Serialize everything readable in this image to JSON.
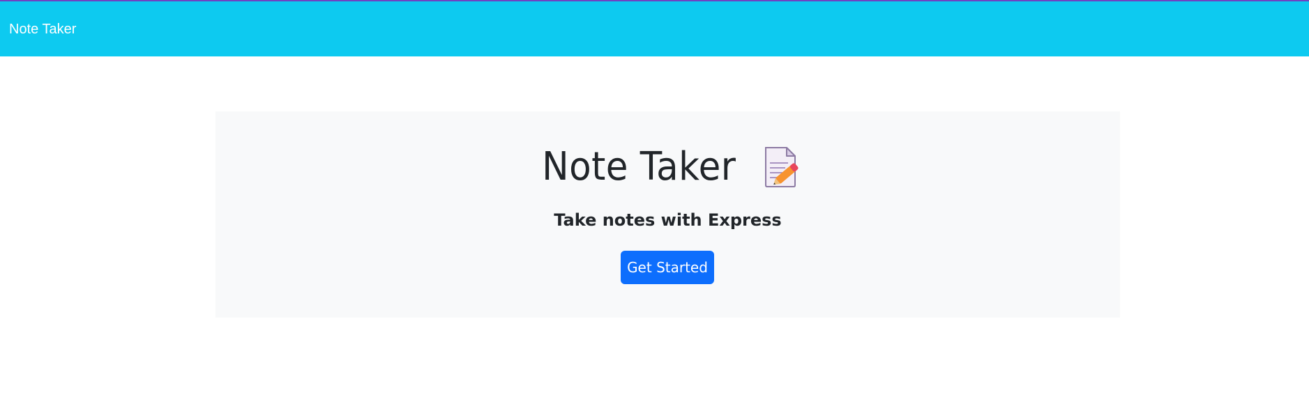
{
  "navbar": {
    "brand": "Note Taker",
    "background_color": "#0dcaf0"
  },
  "hero": {
    "title": "Note Taker",
    "title_icon": "memo-icon",
    "subtitle": "Take notes with Express",
    "button_label": "Get Started",
    "button_color": "#0d6efd",
    "background_color": "#f8f9fa"
  }
}
